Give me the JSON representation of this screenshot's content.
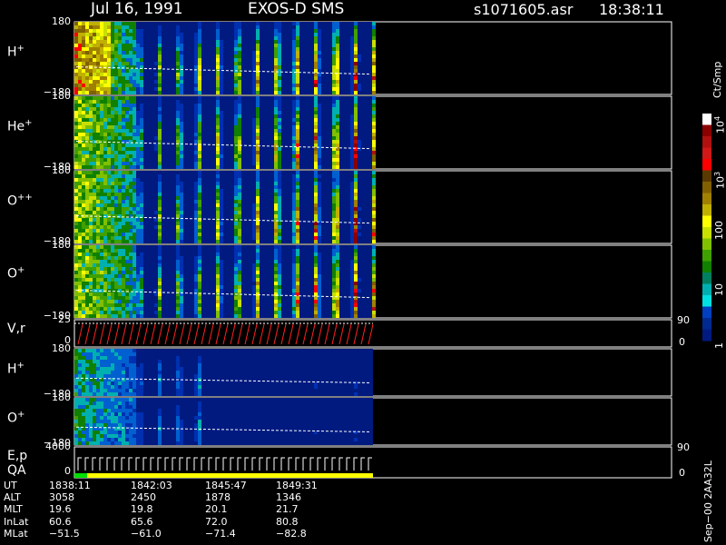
{
  "header": {
    "date": "Jul 16, 1991",
    "instrument": "EXOS-D SMS",
    "file": "s1071605.asr",
    "time": "18:38:11"
  },
  "panels": [
    {
      "label": "H",
      "sup": "+",
      "top": "180",
      "bottom": "−180"
    },
    {
      "label": "He",
      "sup": "+",
      "top": "180",
      "bottom": "−180"
    },
    {
      "label": "O",
      "sup": "++",
      "top": "180",
      "bottom": "−180"
    },
    {
      "label": "O",
      "sup": "+",
      "top": "180",
      "bottom": "−180"
    },
    {
      "label": "V,r",
      "top": "25",
      "bottom": "0",
      "right_top": "90",
      "right_bottom": "0"
    },
    {
      "label": "H",
      "sup": "+",
      "top": "180",
      "bottom": "−180"
    },
    {
      "label": "O",
      "sup": "+",
      "top": "180",
      "bottom": "−180"
    },
    {
      "label": "E,p",
      "label2": "QA",
      "top": "4000",
      "bottom": "0",
      "right_top": "90",
      "right_bottom": "0"
    }
  ],
  "colorbar": {
    "unit": "Ct/Smp",
    "ticks": [
      "10",
      "10",
      "100",
      "10",
      "1"
    ],
    "exponents": [
      "4",
      "3",
      "",
      "",
      ""
    ],
    "colors": [
      "#ffffff",
      "#8b0000",
      "#b01010",
      "#d01818",
      "#ff0000",
      "#5a3a00",
      "#806000",
      "#a08000",
      "#c0b000",
      "#ffff00",
      "#c8e000",
      "#80c000",
      "#40a000",
      "#108000",
      "#008060",
      "#00b0b0",
      "#00e0e0",
      "#0040c0",
      "#002a90",
      "#001a80"
    ]
  },
  "info_table": {
    "rows": [
      {
        "name": "UT",
        "values": [
          "1838:11",
          "1842:03",
          "1845:47",
          "1849:31"
        ]
      },
      {
        "name": "ALT",
        "values": [
          "3058",
          "2450",
          "1878",
          "1346"
        ]
      },
      {
        "name": "MLT",
        "values": [
          "19.6",
          "19.8",
          "20.1",
          "21.7"
        ]
      },
      {
        "name": "InLat",
        "values": [
          "60.6",
          "65.6",
          "72.0",
          "80.8"
        ]
      },
      {
        "name": "MLat",
        "values": [
          "−51.5",
          "−61.0",
          "−71.4",
          "−82.8"
        ]
      }
    ]
  },
  "side_note": "Sep−00 2AA32L",
  "chart_data": {
    "type": "heatmap",
    "title": "Jul 16, 1991 EXOS-D SMS",
    "xlabel": "UT",
    "x_ticks": [
      "1838:11",
      "1842:03",
      "1845:47",
      "1849:31"
    ],
    "y_range": [
      -180,
      180
    ],
    "series": [
      {
        "name": "H+",
        "intensity": "spin-modulated stripes, peak ~10^3 Ct/Smp"
      },
      {
        "name": "He+",
        "intensity": "spin-modulated stripes, peak ~10^3 Ct/Smp"
      },
      {
        "name": "O++",
        "intensity": "spin-modulated stripes, peak ~10^3 Ct/Smp"
      },
      {
        "name": "O+",
        "intensity": "spin-modulated stripes, peak ~100 Ct/Smp"
      },
      {
        "name": "H+ (lower)",
        "intensity": "low counts, ~10 Ct/Smp"
      },
      {
        "name": "O+ (lower)",
        "intensity": "low counts, ~10 Ct/Smp"
      }
    ],
    "color_scale": {
      "min": 1,
      "max": 10000,
      "scale": "log"
    }
  }
}
